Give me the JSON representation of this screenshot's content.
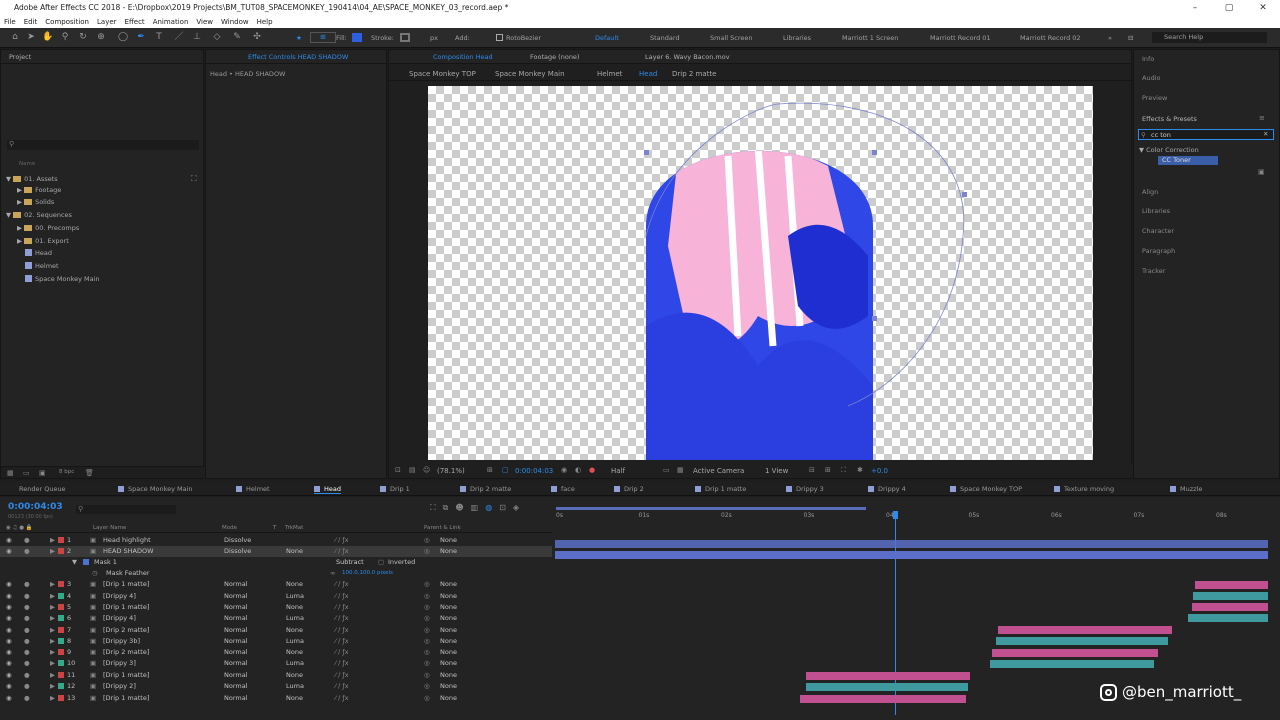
{
  "window": {
    "title": "Adobe After Effects CC 2018 - E:\\Dropbox\\2019 Projects\\BM_TUT08_SPACEMONKEY_190414\\04_AE\\SPACE_MONKEY_03_record.aep *"
  },
  "menu": [
    "File",
    "Edit",
    "Composition",
    "Layer",
    "Effect",
    "Animation",
    "View",
    "Window",
    "Help"
  ],
  "toolbar": {
    "fill_label": "Fill:",
    "stroke_label": "Stroke:",
    "px_label": "px",
    "add_label": "Add:",
    "rotobezier": "RotoBezier",
    "search_help": "Search Help",
    "workspaces": [
      "Default",
      "Standard",
      "Small Screen",
      "Libraries",
      "Marriott 1 Screen",
      "Marriott Record 01",
      "Marriott Record 02"
    ]
  },
  "project": {
    "title": "Project",
    "search_placeholder": "",
    "col_name": "Name",
    "tree": [
      {
        "label": "01. Assets",
        "type": "folder",
        "indent": 0
      },
      {
        "label": "Footage",
        "type": "folder",
        "indent": 1
      },
      {
        "label": "Solids",
        "type": "folder",
        "indent": 1
      },
      {
        "label": "02. Sequences",
        "type": "folder",
        "indent": 0
      },
      {
        "label": "00. Precomps",
        "type": "folder",
        "indent": 1
      },
      {
        "label": "01. Export",
        "type": "folder",
        "indent": 1
      },
      {
        "label": "Head",
        "type": "comp",
        "indent": 1
      },
      {
        "label": "Helmet",
        "type": "comp",
        "indent": 1
      },
      {
        "label": "Space Monkey Main",
        "type": "comp",
        "indent": 1
      }
    ],
    "bpc": "8 bpc"
  },
  "effect_controls": {
    "title": "Effect Controls HEAD SHADOW",
    "subtitle": "Head • HEAD SHADOW"
  },
  "composition": {
    "tab": "Composition Head",
    "footage_tab": "Footage (none)",
    "layer_tab": "Layer 6. Wavy Bacon.mov",
    "breadcrumbs": [
      "Space Monkey TOP",
      "Space Monkey Main",
      "Helmet",
      "Head",
      "Drip 2 matte"
    ],
    "zoom": "(78.1%)",
    "timecode": "0:00:04:03",
    "resolution": "Half",
    "camera": "Active Camera",
    "views": "1 View",
    "exposure": "+0.0"
  },
  "right_panel": {
    "items": [
      "Info",
      "Audio",
      "Preview",
      "Effects & Presets"
    ],
    "search_value": "cc ton",
    "category": "Color Correction",
    "effect": "CC Toner",
    "more": [
      "Align",
      "Libraries",
      "Character",
      "Paragraph",
      "Tracker"
    ]
  },
  "timeline": {
    "tabs": [
      {
        "label": "Render Queue",
        "color": ""
      },
      {
        "label": "Space Monkey Main",
        "color": "#8f9fd6"
      },
      {
        "label": "Helmet",
        "color": "#8f9fd6"
      },
      {
        "label": "Head",
        "color": "#8f9fd6"
      },
      {
        "label": "Drip 1",
        "color": "#8f9fd6"
      },
      {
        "label": "Drip 2 matte",
        "color": "#8f9fd6"
      },
      {
        "label": "face",
        "color": "#8f9fd6"
      },
      {
        "label": "Drip 2",
        "color": "#8f9fd6"
      },
      {
        "label": "Drip 1 matte",
        "color": "#8f9fd6"
      },
      {
        "label": "Drippy 3",
        "color": "#8f9fd6"
      },
      {
        "label": "Drippy 4",
        "color": "#8f9fd6"
      },
      {
        "label": "Space Monkey TOP",
        "color": "#8f9fd6"
      },
      {
        "label": "Texture moving",
        "color": "#8f9fd6"
      },
      {
        "label": "Muzzle",
        "color": "#8f9fd6"
      }
    ],
    "current_time": "0:00:04:03",
    "frames": "00123 (30.00 fps)",
    "cols": {
      "layer_name": "Layer Name",
      "mode": "Mode",
      "t": "T",
      "trkmat": "TrkMat",
      "parent": "Parent & Link"
    },
    "ruler": [
      "0s",
      "01s",
      "02s",
      "03s",
      "04s",
      "05s",
      "06s",
      "07s",
      "08s"
    ],
    "mask": {
      "name": "Mask 1",
      "mode": "Subtract",
      "inverted": "Inverted",
      "feather_label": "Mask Feather",
      "feather_value": "100.0,100.0 pixels"
    },
    "layers": [
      {
        "num": "1",
        "name": "Head highlight",
        "mode": "Dissolve",
        "trk": "",
        "parent": "None",
        "color": "#c44"
      },
      {
        "num": "2",
        "name": "HEAD SHADOW",
        "mode": "Dissolve",
        "trk": "None",
        "parent": "None",
        "color": "#c44"
      },
      {
        "num": "3",
        "name": "[Drip 1 matte]",
        "mode": "Normal",
        "trk": "None",
        "parent": "None",
        "color": "#c44"
      },
      {
        "num": "4",
        "name": "[Drippy 4]",
        "mode": "Normal",
        "trk": "Luma",
        "parent": "None",
        "color": "#3a8"
      },
      {
        "num": "5",
        "name": "[Drip 1 matte]",
        "mode": "Normal",
        "trk": "None",
        "parent": "None",
        "color": "#c44"
      },
      {
        "num": "6",
        "name": "[Drippy 4]",
        "mode": "Normal",
        "trk": "Luma",
        "parent": "None",
        "color": "#3a8"
      },
      {
        "num": "7",
        "name": "[Drip 2 matte]",
        "mode": "Normal",
        "trk": "None",
        "parent": "None",
        "color": "#c44"
      },
      {
        "num": "8",
        "name": "[Drippy 3b]",
        "mode": "Normal",
        "trk": "Luma",
        "parent": "None",
        "color": "#3a8"
      },
      {
        "num": "9",
        "name": "[Drip 2 matte]",
        "mode": "Normal",
        "trk": "None",
        "parent": "None",
        "color": "#c44"
      },
      {
        "num": "10",
        "name": "[Drippy 3]",
        "mode": "Normal",
        "trk": "Luma",
        "parent": "None",
        "color": "#3a8"
      },
      {
        "num": "11",
        "name": "[Drip 1 matte]",
        "mode": "Normal",
        "trk": "None",
        "parent": "None",
        "color": "#c44"
      },
      {
        "num": "12",
        "name": "[Drippy 2]",
        "mode": "Normal",
        "trk": "Luma",
        "parent": "None",
        "color": "#3a8"
      },
      {
        "num": "13",
        "name": "[Drip 1 matte]",
        "mode": "Normal",
        "trk": "None",
        "parent": "None",
        "color": "#c44"
      }
    ]
  },
  "watermark": {
    "handle": "@ben_marriott_"
  },
  "colors": {
    "accent": "#2d8ceb",
    "bar_main": "#5b6ec9",
    "bar_pink": "#c0508f",
    "bar_teal": "#3f9aa0"
  }
}
